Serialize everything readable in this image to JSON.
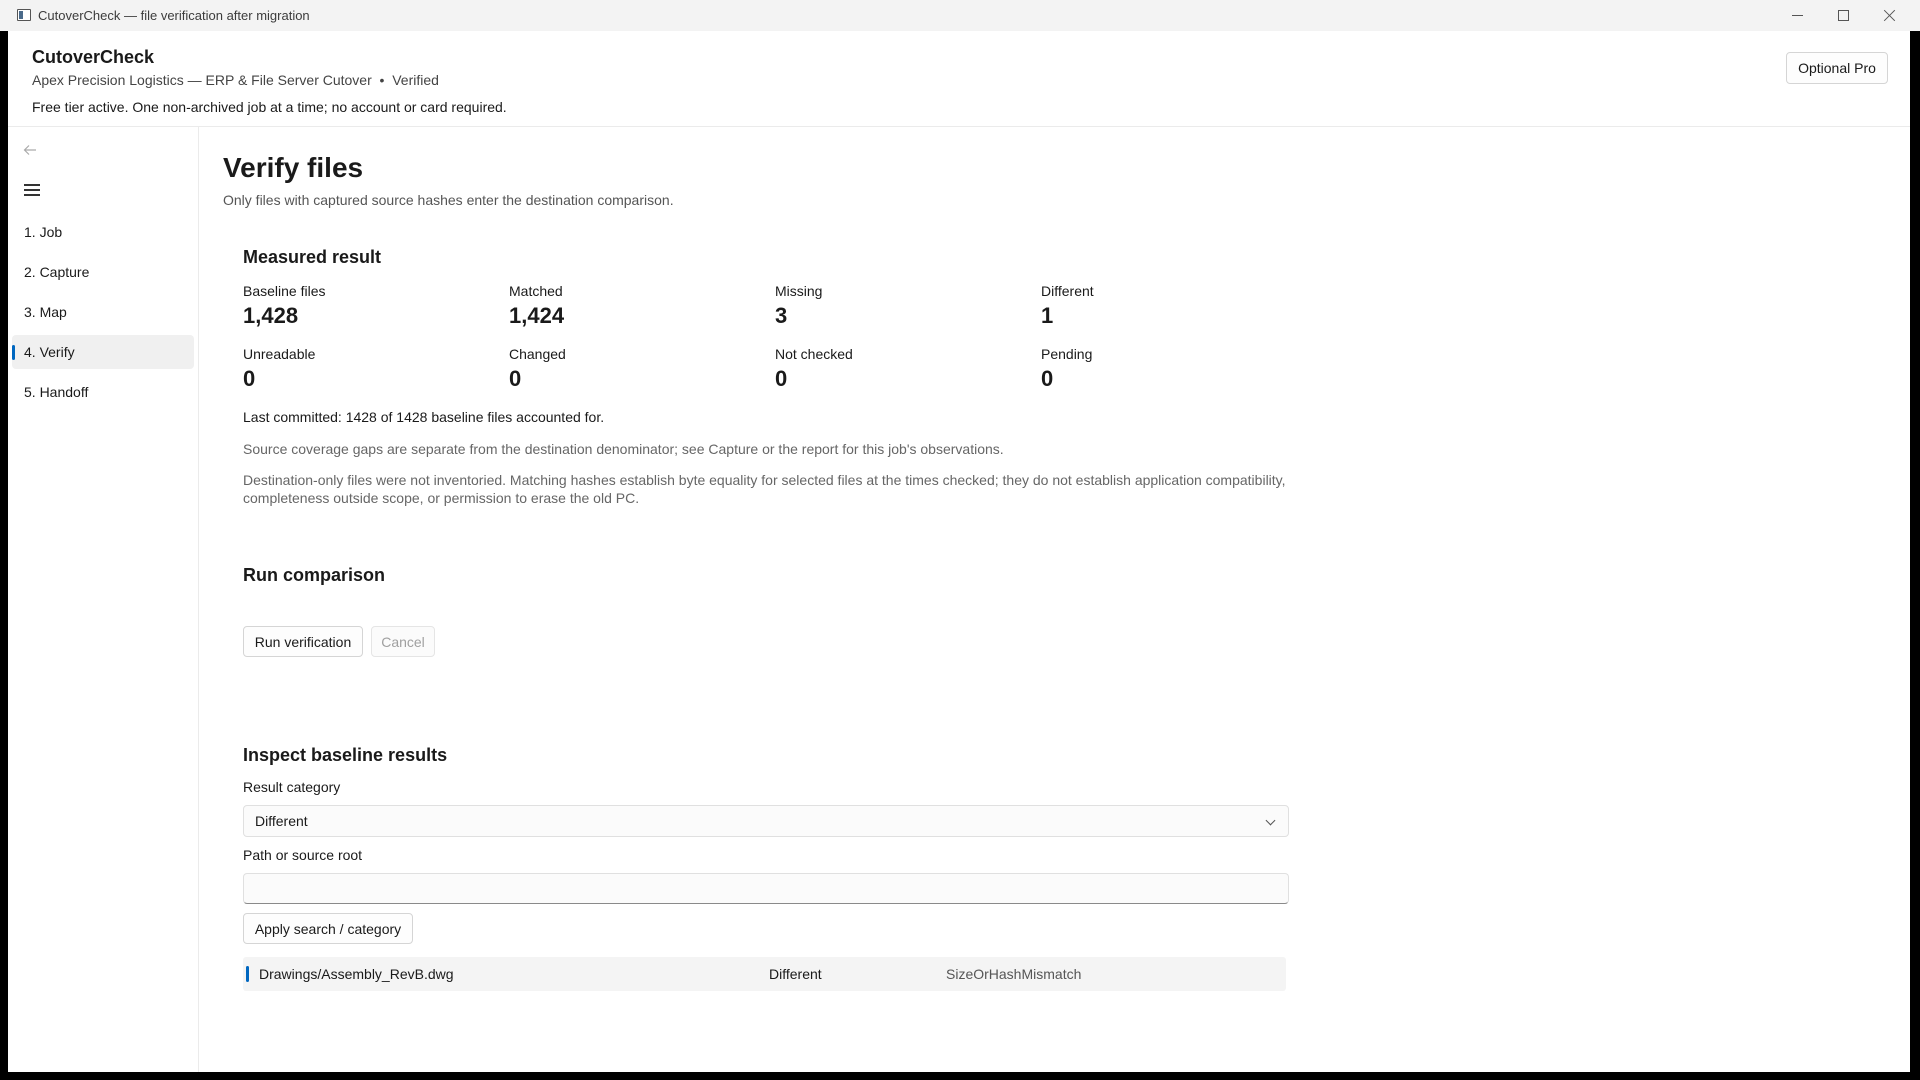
{
  "window": {
    "title": "CutoverCheck — file verification after migration"
  },
  "header": {
    "app_name": "CutoverCheck",
    "job_line": "Apex Precision Logistics — ERP & File Server Cutover  •  Verified",
    "tier_line": "Free tier active. One non-archived job at a time; no account or card required.",
    "pro_button": "Optional Pro"
  },
  "nav": {
    "items": [
      {
        "label": "1. Job"
      },
      {
        "label": "2. Capture"
      },
      {
        "label": "3. Map"
      },
      {
        "label": "4. Verify",
        "active": true
      },
      {
        "label": "5. Handoff"
      }
    ]
  },
  "page": {
    "title": "Verify files",
    "subtitle": "Only files with captured source hashes enter the destination comparison."
  },
  "measured": {
    "title": "Measured result",
    "metrics": [
      {
        "label": "Baseline files",
        "value": "1,428"
      },
      {
        "label": "Matched",
        "value": "1,424"
      },
      {
        "label": "Missing",
        "value": "3"
      },
      {
        "label": "Different",
        "value": "1"
      },
      {
        "label": "Unreadable",
        "value": "0"
      },
      {
        "label": "Changed",
        "value": "0"
      },
      {
        "label": "Not checked",
        "value": "0"
      },
      {
        "label": "Pending",
        "value": "0"
      }
    ],
    "last_committed": "Last committed: 1428 of 1428 baseline files accounted for.",
    "coverage_note": "Source coverage gaps are separate from the destination denominator; see Capture or the report for this job's observations.",
    "disclaimer": "Destination-only files were not inventoried. Matching hashes establish byte equality for selected files at the times checked; they do not establish application compatibility, completeness outside scope, or permission to erase the old PC."
  },
  "run": {
    "title": "Run comparison",
    "run_button": "Run verification",
    "cancel_button": "Cancel"
  },
  "inspect": {
    "title": "Inspect baseline results",
    "category_label": "Result category",
    "category_value": "Different",
    "path_label": "Path or source root",
    "path_value": "",
    "apply_button": "Apply search / category",
    "rows": [
      {
        "path": "Drawings/Assembly_RevB.dwg",
        "status": "Different",
        "reason": "SizeOrHashMismatch"
      }
    ]
  }
}
